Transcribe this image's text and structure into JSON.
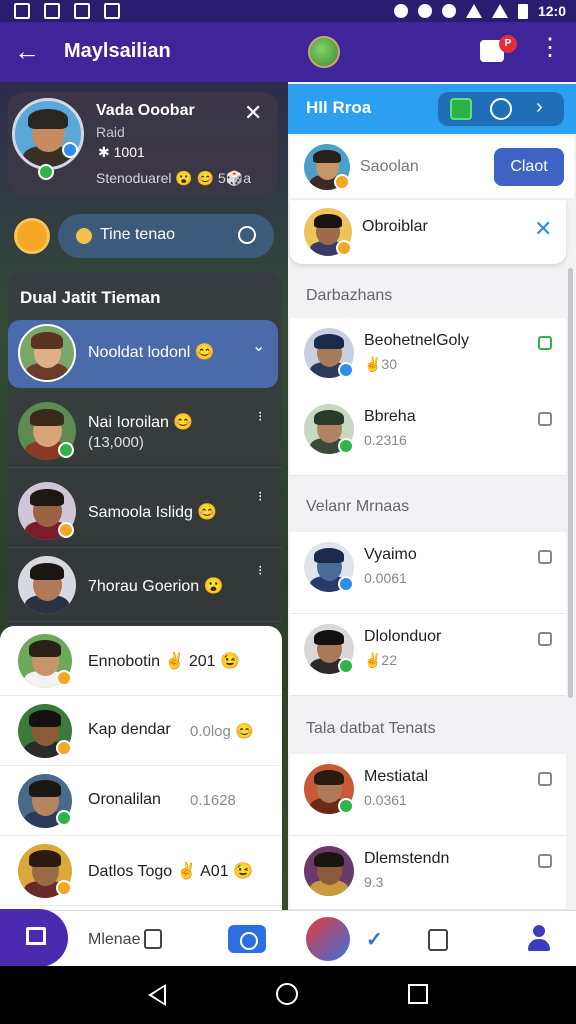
{
  "status_bar": {
    "time": "12:0"
  },
  "app_bar": {
    "title": "Maylsailian",
    "chat_badge": "P"
  },
  "profile_card": {
    "name": "Vada Ooobar",
    "subtitle": "Raid",
    "score": "✱ 1001",
    "status": "Stenoduarel 😮 😊 5🎲a"
  },
  "status_pill": {
    "text": "Tine tenao"
  },
  "friends_panel": {
    "header": "Dual Jatit Tieman",
    "selected": {
      "label": "Nooldat lodonl 😊"
    },
    "rows": [
      {
        "label": "Nai Ioroilan 😊",
        "sub": "(13,000)"
      },
      {
        "label": "Samoola Islidg 😊",
        "sub": ""
      },
      {
        "label": "7horau Goerion 😮",
        "sub": ""
      }
    ]
  },
  "left_list": [
    {
      "label": "Ennobotin ✌ 201 😉",
      "value": ""
    },
    {
      "label": "Kap dendar",
      "value": "0.0log 😊"
    },
    {
      "label": "Oronalilan",
      "value": "0.1628"
    },
    {
      "label": "Datlos Togo ✌ A01 😉",
      "value": ""
    }
  ],
  "right_panel": {
    "header_title": "Hll Rroa",
    "search_label": "Saoolan",
    "search_button": "Claot",
    "pinned_label": "Obroiblar",
    "sections": [
      {
        "title": "Darbazhans",
        "rows": [
          {
            "label": "BeohetnelGoly",
            "value": "✌30"
          },
          {
            "label": "Bbreha",
            "value": "0.2316"
          }
        ]
      },
      {
        "title": "Velanr Mrnaas",
        "rows": [
          {
            "label": "Vyaimo",
            "value": "0.0061"
          },
          {
            "label": "Dlolonduor",
            "value": "✌22"
          }
        ]
      },
      {
        "title": "Tala datbat Tenats",
        "rows": [
          {
            "label": "Mestiatal",
            "value": "0.0361"
          },
          {
            "label": "Dlemstendn",
            "value": "9.3"
          }
        ]
      }
    ]
  },
  "bottom_nav": {
    "label": "Mlenae"
  },
  "colors": {
    "app_bar": "#40249a",
    "accent_blue": "#2d9ff0",
    "button_blue": "#3f63c4",
    "online_green": "#2fb34a"
  },
  "icons": [
    "back-arrow-icon",
    "chat-icon",
    "more-icon",
    "close-icon",
    "home-icon",
    "lock-icon",
    "gamepad-icon",
    "profile-icon",
    "check-icon"
  ]
}
